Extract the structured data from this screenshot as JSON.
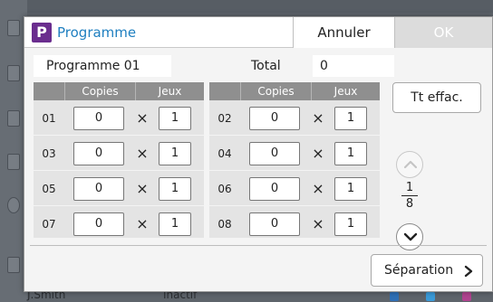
{
  "background": {
    "user_name": "J.Smith",
    "user_status": "Inactif"
  },
  "dialog": {
    "badge_letter": "P",
    "title": "Programme",
    "cancel_label": "Annuler",
    "ok_label": "OK",
    "program_name": "Programme 01",
    "total_label": "Total",
    "total_value": "0",
    "clear_all_label": "Tt effac.",
    "separation_label": "Séparation",
    "page_current": "1",
    "page_total": "8",
    "headers": {
      "copies": "Copies",
      "sets": "Jeux"
    },
    "rows": [
      {
        "num": "01",
        "copies": "0",
        "times": "×",
        "sets": "1"
      },
      {
        "num": "02",
        "copies": "0",
        "times": "×",
        "sets": "1"
      },
      {
        "num": "03",
        "copies": "0",
        "times": "×",
        "sets": "1"
      },
      {
        "num": "04",
        "copies": "0",
        "times": "×",
        "sets": "1"
      },
      {
        "num": "05",
        "copies": "0",
        "times": "×",
        "sets": "1"
      },
      {
        "num": "06",
        "copies": "0",
        "times": "×",
        "sets": "1"
      },
      {
        "num": "07",
        "copies": "0",
        "times": "×",
        "sets": "1"
      },
      {
        "num": "08",
        "copies": "0",
        "times": "×",
        "sets": "1"
      }
    ]
  },
  "colors": {
    "title_blue": "#1f7fc0",
    "badge_purple": "#6a2d8e",
    "header_gray": "#8f8f8f"
  }
}
